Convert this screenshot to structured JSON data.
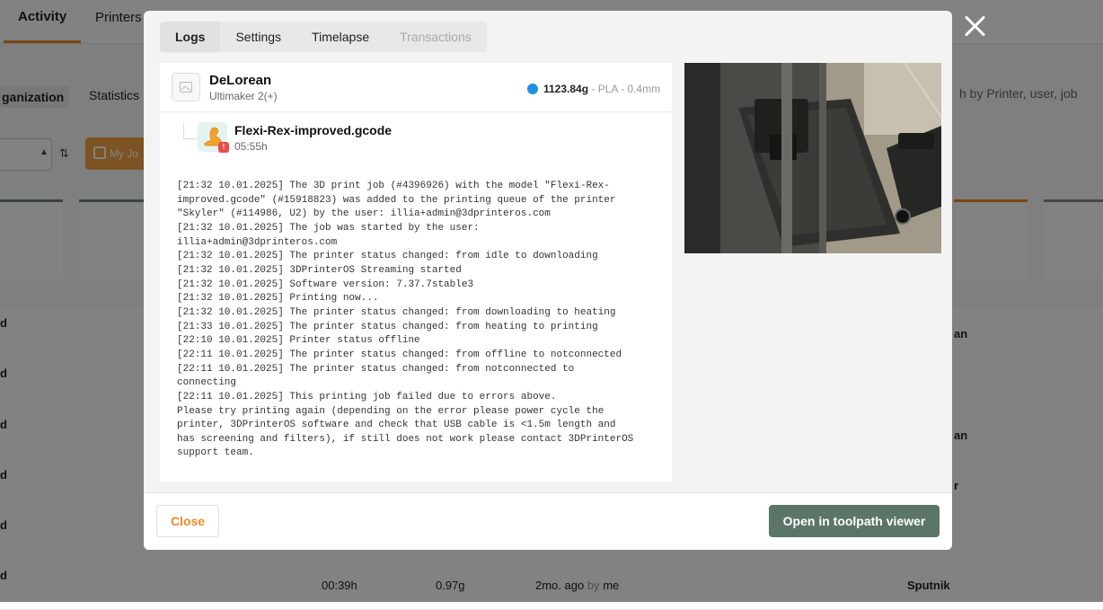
{
  "background": {
    "nav": {
      "activity": "Activity",
      "printers": "Printers"
    },
    "subnav": {
      "organization": "ganization",
      "statistics": "Statistics",
      "search_placeholder": "h by Printer, user, job"
    },
    "filters": {
      "sort_icon": "sort-desc-icon",
      "my_jobs": "My Jo"
    },
    "rows": [
      {
        "left": "d",
        "right": "an"
      },
      {
        "left": "d",
        "right": ""
      },
      {
        "left": "d",
        "right": "an"
      },
      {
        "left": "d",
        "right": "r"
      },
      {
        "left": "d",
        "right": ""
      },
      {
        "left": "d",
        "right": ""
      }
    ],
    "last_row": {
      "time": "00:39h",
      "weight": "0.97g",
      "ago": "2mo. ago",
      "by": "by",
      "user": "me",
      "printer": "Sputnik"
    }
  },
  "modal": {
    "tabs": [
      {
        "label": "Logs",
        "state": "active"
      },
      {
        "label": "Settings",
        "state": "normal"
      },
      {
        "label": "Timelapse",
        "state": "normal"
      },
      {
        "label": "Transactions",
        "state": "disabled"
      }
    ],
    "printer": {
      "name": "DeLorean",
      "model": "Ultimaker 2(+)",
      "filament_weight": "1123.84g",
      "separator": " - ",
      "filament_type": "PLA",
      "nozzle": "0.4mm",
      "filament_color": "#1e8fe3"
    },
    "job": {
      "file": "Flexi-Rex-improved.gcode",
      "duration": "05:55h",
      "badge": "!"
    },
    "log": "[21:32 10.01.2025] The 3D print job (#4396926) with the model \"Flexi-Rex-\nimproved.gcode\" (#15918823) was added to the printing queue of the printer\n\"Skyler\" (#114986, U2) by the user: illia+admin@3dprinteros.com\n[21:32 10.01.2025] The job was started by the user:\nillia+admin@3dprinteros.com\n[21:32 10.01.2025] The printer status changed: from idle to downloading\n[21:32 10.01.2025] 3DPrinterOS Streaming started\n[21:32 10.01.2025] Software version: 7.37.7stable3\n[21:32 10.01.2025] Printing now...\n[21:32 10.01.2025] The printer status changed: from downloading to heating\n[21:33 10.01.2025] The printer status changed: from heating to printing\n[22:10 10.01.2025] Printer status offline\n[22:11 10.01.2025] The printer status changed: from offline to notconnected\n[22:11 10.01.2025] The printer status changed: from notconnected to\nconnecting\n[22:11 10.01.2025] This printing job failed due to errors above.\nPlease try printing again (depending on the error please power cycle the\nprinter, 3DPrinterOS software and check that USB cable is <1.5m length and\nhas screening and filters), if still does not work please contact 3DPrinterOS\nsupport team.",
    "footer": {
      "close": "Close",
      "toolpath": "Open in toolpath viewer"
    },
    "colors": {
      "accent": "#f08a24",
      "primary_button": "#5b7566"
    }
  }
}
